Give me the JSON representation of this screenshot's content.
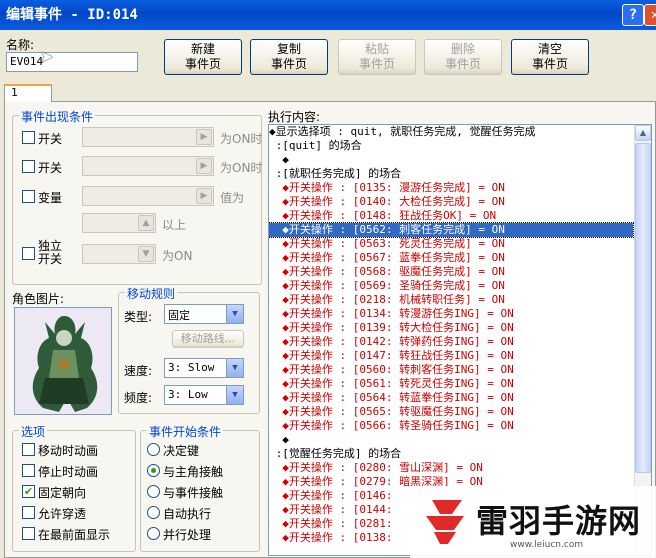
{
  "window": {
    "title": "编辑事件 - ID:014"
  },
  "name_field": {
    "label": "名称:",
    "value": "EV014"
  },
  "toolbar": {
    "new_page": "新建\n事件页",
    "copy_page": "复制\n事件页",
    "paste_page": "粘贴\n事件页",
    "delete_page": "删除\n事件页",
    "clear_page": "清空\n事件页"
  },
  "tabs": [
    {
      "label": "1"
    }
  ],
  "conditions": {
    "title": "事件出现条件",
    "switch1": {
      "label": "开关",
      "suffix": "为ON时",
      "checked": false
    },
    "switch2": {
      "label": "开关",
      "suffix": "为ON时",
      "checked": false
    },
    "variable": {
      "label": "变量",
      "suffix": "值为",
      "checked": false
    },
    "above": "以上",
    "self_switch": {
      "label": "独立\n开关",
      "suffix": "为ON",
      "checked": false
    }
  },
  "character": {
    "label": "角色图片:"
  },
  "movement": {
    "title": "移动规则",
    "type_label": "类型:",
    "type_value": "固定",
    "route_button": "移动路线...",
    "speed_label": "速度:",
    "speed_value": "3: Slow",
    "freq_label": "频度:",
    "freq_value": "3: Low"
  },
  "options": {
    "title": "选项",
    "items": [
      {
        "label": "移动时动画",
        "checked": false
      },
      {
        "label": "停止时动画",
        "checked": false
      },
      {
        "label": "固定朝向",
        "checked": true
      },
      {
        "label": "允许穿透",
        "checked": false
      },
      {
        "label": "在最前面显示",
        "checked": false
      }
    ]
  },
  "trigger": {
    "title": "事件开始条件",
    "items": [
      {
        "label": "决定键",
        "selected": false
      },
      {
        "label": "与主角接触",
        "selected": true
      },
      {
        "label": "与事件接触",
        "selected": false
      },
      {
        "label": "自动执行",
        "selected": false
      },
      {
        "label": "并行处理",
        "selected": false
      }
    ]
  },
  "commands": {
    "label": "执行内容:",
    "rows": [
      {
        "text": "◆显示选择项 : quit, 就职任务完成, 觉醒任务完成",
        "style": ""
      },
      {
        "text": " :[quit] 的场合",
        "style": ""
      },
      {
        "text": "  ◆",
        "style": ""
      },
      {
        "text": " :[就职任务完成] 的场合",
        "style": ""
      },
      {
        "text": "  ◆开关操作 : [0135: 漫游任务完成] = ON",
        "style": "red"
      },
      {
        "text": "  ◆开关操作 : [0140: 大检任务完成] = ON",
        "style": "red"
      },
      {
        "text": "  ◆开关操作 : [0148: 狂战任务OK] = ON",
        "style": "red"
      },
      {
        "text": "  ◆开关操作 : [0562: 刺客任务完成] = ON",
        "style": "sel"
      },
      {
        "text": "  ◆开关操作 : [0563: 死灵任务完成] = ON",
        "style": "red"
      },
      {
        "text": "  ◆开关操作 : [0567: 蓝拳任务完成] = ON",
        "style": "red"
      },
      {
        "text": "  ◆开关操作 : [0568: 驱魔任务完成] = ON",
        "style": "red"
      },
      {
        "text": "  ◆开关操作 : [0569: 圣骑任务完成] = ON",
        "style": "red"
      },
      {
        "text": "  ◆开关操作 : [0218: 机械转职任务] = ON",
        "style": "red"
      },
      {
        "text": "  ◆开关操作 : [0134: 转漫游任务ING] = ON",
        "style": "red"
      },
      {
        "text": "  ◆开关操作 : [0139: 转大检任务ING] = ON",
        "style": "red"
      },
      {
        "text": "  ◆开关操作 : [0142: 转弹药任务ING] = ON",
        "style": "red"
      },
      {
        "text": "  ◆开关操作 : [0147: 转狂战任务ING] = ON",
        "style": "red"
      },
      {
        "text": "  ◆开关操作 : [0560: 转刺客任务ING] = ON",
        "style": "red"
      },
      {
        "text": "  ◆开关操作 : [0561: 转死灵任务ING] = ON",
        "style": "red"
      },
      {
        "text": "  ◆开关操作 : [0564: 转蓝拳任务ING] = ON",
        "style": "red"
      },
      {
        "text": "  ◆开关操作 : [0565: 转驱魔任务ING] = ON",
        "style": "red"
      },
      {
        "text": "  ◆开关操作 : [0566: 转圣骑任务ING] = ON",
        "style": "red"
      },
      {
        "text": "  ◆",
        "style": ""
      },
      {
        "text": " :[觉醒任务完成] 的场合",
        "style": ""
      },
      {
        "text": "  ◆开关操作 : [0280: 雪山深渊] = ON",
        "style": "red"
      },
      {
        "text": "  ◆开关操作 : [0279: 暗黑深渊] = ON",
        "style": "red"
      },
      {
        "text": "  ◆开关操作 : [0146:",
        "style": "red"
      },
      {
        "text": "  ◆开关操作 : [0144:",
        "style": "red"
      },
      {
        "text": "  ◆开关操作 : [0281:",
        "style": "red"
      },
      {
        "text": "  ◆开关操作 : [0138:",
        "style": "red"
      }
    ]
  },
  "watermark": {
    "text": "雷羽手游网",
    "url": "www.leiucn.com",
    "accent": "#e02a2a"
  }
}
